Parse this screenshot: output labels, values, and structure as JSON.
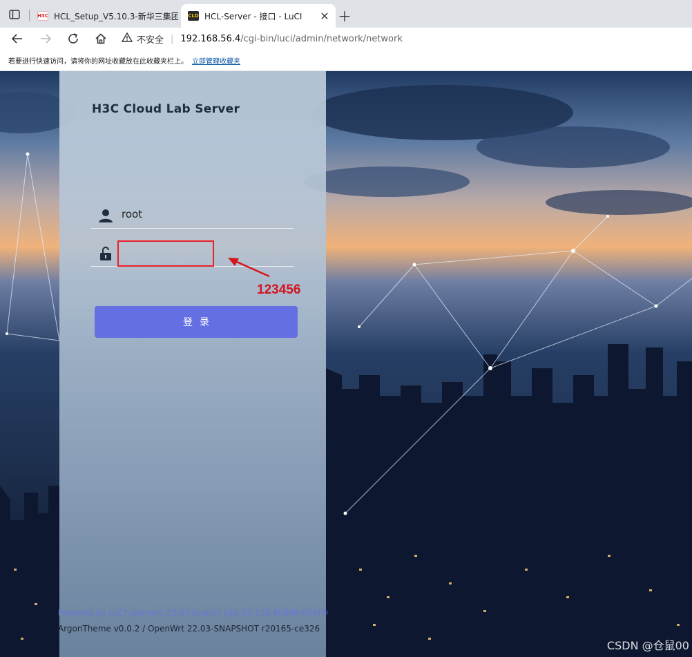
{
  "browser": {
    "tabs": [
      {
        "title": "HCL_Setup_V5.10.3-新华三集团-",
        "favicon": "H3C"
      },
      {
        "title": "HCL-Server - 接口 - LuCI",
        "favicon": "CLD"
      }
    ],
    "address": {
      "security_label": "不安全",
      "host": "192.168.56.4",
      "path": "/cgi-bin/luci/admin/network/network"
    },
    "bookmarks_bar": {
      "hint": "若要进行快速访问，请将你的网址收藏放在此收藏夹栏上。",
      "link": "立即管理收藏夹"
    }
  },
  "login": {
    "brand": "H3C Cloud Lab Server",
    "username": "root",
    "password_value": "",
    "submit_label": "登录"
  },
  "footer": {
    "powered_by": "Powered by LuCI openwrt-22.03 branch (git-23.119.80898-65ef408",
    "theme": "ArgonTheme v0.0.2 / OpenWrt 22.03-SNAPSHOT r20165-ce326"
  },
  "annotation": {
    "text": "123456",
    "color": "#d4151c"
  },
  "watermark": "CSDN @仓鼠00",
  "colors": {
    "button": "#6470e2",
    "powered_link": "#6a76d6"
  }
}
